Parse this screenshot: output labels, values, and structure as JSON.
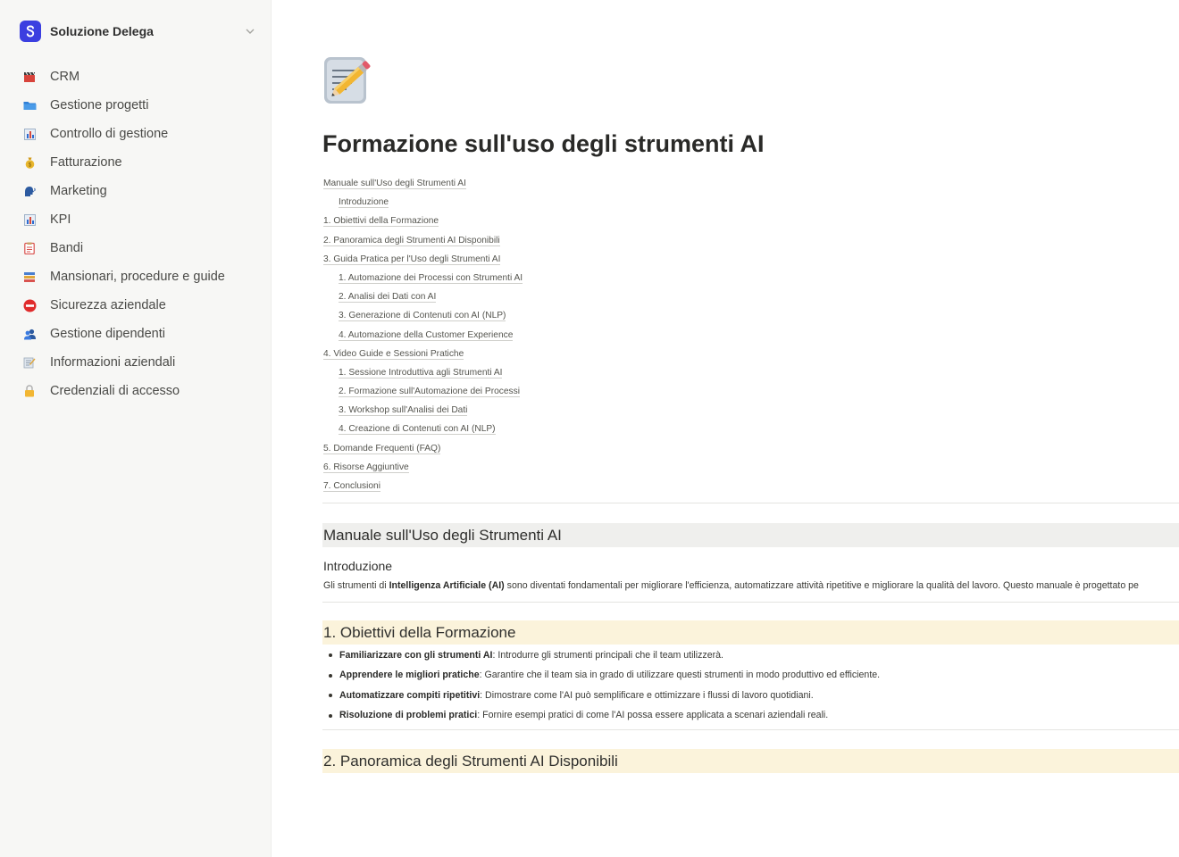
{
  "workspace": {
    "name": "Soluzione Delega",
    "logo_color": "#3b3fe0"
  },
  "sidebar": {
    "items": [
      {
        "label": "CRM",
        "icon": "film-clapper-icon"
      },
      {
        "label": "Gestione progetti",
        "icon": "folder-icon"
      },
      {
        "label": "Controllo di gestione",
        "icon": "bar-chart-icon"
      },
      {
        "label": "Fatturazione",
        "icon": "money-bag-icon"
      },
      {
        "label": "Marketing",
        "icon": "speaking-head-icon"
      },
      {
        "label": "KPI",
        "icon": "bar-chart-icon"
      },
      {
        "label": "Bandi",
        "icon": "clipboard-icon"
      },
      {
        "label": "Mansionari, procedure e guide",
        "icon": "books-icon"
      },
      {
        "label": "Sicurezza aziendale",
        "icon": "no-entry-icon"
      },
      {
        "label": "Gestione dipendenti",
        "icon": "people-icon"
      },
      {
        "label": "Informazioni aziendali",
        "icon": "memo-icon"
      },
      {
        "label": "Credenziali di accesso",
        "icon": "lock-icon"
      }
    ]
  },
  "page": {
    "icon": "memo-pencil-icon",
    "title": "Formazione sull'uso degli strumenti AI"
  },
  "toc": [
    {
      "label": "Manuale sull'Uso degli Strumenti AI",
      "level": 1
    },
    {
      "label": "Introduzione",
      "level": 2
    },
    {
      "label": "1. Obiettivi della Formazione",
      "level": 1
    },
    {
      "label": "2. Panoramica degli Strumenti AI Disponibili",
      "level": 1
    },
    {
      "label": "3. Guida Pratica per l'Uso degli Strumenti AI",
      "level": 1
    },
    {
      "label": "1. Automazione dei Processi con Strumenti AI",
      "level": 2
    },
    {
      "label": "2. Analisi dei Dati con AI",
      "level": 2
    },
    {
      "label": "3. Generazione di Contenuti con AI (NLP)",
      "level": 2
    },
    {
      "label": "4. Automazione della Customer Experience",
      "level": 2
    },
    {
      "label": "4. Video Guide e Sessioni Pratiche",
      "level": 1
    },
    {
      "label": "1. Sessione Introduttiva agli Strumenti AI",
      "level": 2
    },
    {
      "label": "2. Formazione sull'Automazione dei Processi",
      "level": 2
    },
    {
      "label": "3. Workshop sull'Analisi dei Dati",
      "level": 2
    },
    {
      "label": "4. Creazione di Contenuti con AI (NLP)",
      "level": 2
    },
    {
      "label": "5. Domande Frequenti (FAQ)",
      "level": 1
    },
    {
      "label": "6. Risorse Aggiuntive",
      "level": 1
    },
    {
      "label": "7. Conclusioni",
      "level": 1
    }
  ],
  "sections": {
    "manual_heading": "Manuale sull'Uso degli Strumenti AI",
    "intro_heading": "Introduzione",
    "intro_text_1": "Gli strumenti di ",
    "intro_text_bold": "Intelligenza Artificiale (AI)",
    "intro_text_2": " sono diventati fondamentali per migliorare l'efficienza, automatizzare attività ripetitive e migliorare la qualità del lavoro. Questo manuale è progettato pe",
    "objectives_heading": "1. Obiettivi della Formazione",
    "objectives": [
      {
        "bold": "Familiarizzare con gli strumenti AI",
        "text": ": Introdurre gli strumenti principali che il team utilizzerà."
      },
      {
        "bold": "Apprendere le migliori pratiche",
        "text": ": Garantire che il team sia in grado di utilizzare questi strumenti in modo produttivo ed efficiente."
      },
      {
        "bold": "Automatizzare compiti ripetitivi",
        "text": ": Dimostrare come l'AI può semplificare e ottimizzare i flussi di lavoro quotidiani."
      },
      {
        "bold": "Risoluzione di problemi pratici",
        "text": ": Fornire esempi pratici di come l'AI possa essere applicata a scenari aziendali reali."
      }
    ],
    "overview_heading": "2. Panoramica degli Strumenti AI Disponibili"
  },
  "colors": {
    "sidebar_bg": "#f7f7f5",
    "heading_gray_bg": "#efefed",
    "heading_yellow_bg": "#fbf3db"
  }
}
